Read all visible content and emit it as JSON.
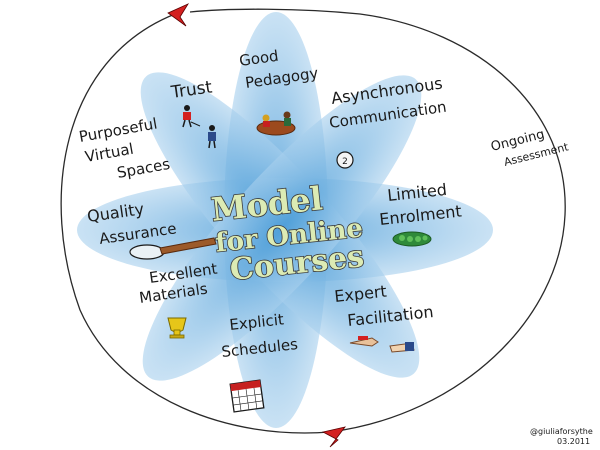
{
  "title": {
    "line1": "Model",
    "line2": "for Online",
    "line3": "Courses"
  },
  "petals": {
    "trust": "Trust",
    "good_pedagogy": [
      "Good",
      "Pedagogy"
    ],
    "asynchronous_communication": [
      "Asynchronous",
      "Communication"
    ],
    "limited_enrolment": [
      "Limited",
      "Enrolment"
    ],
    "expert_facilitation": [
      "Expert",
      "Facilitation"
    ],
    "explicit_schedules": [
      "Explicit",
      "Schedules"
    ],
    "excellent_materials": [
      "Excellent",
      "Materials"
    ],
    "quality_assurance": [
      "Quality",
      "Assurance"
    ]
  },
  "outer_left": [
    "Purposeful",
    "Virtual",
    "Spaces"
  ],
  "outer_right": [
    "Ongoing",
    "Assessment"
  ],
  "signature": [
    "@giuliaforsythe",
    "03.2011"
  ],
  "icons": [
    "people-icon",
    "dinner-table-icon",
    "speech-bubble-icon",
    "peas-pod-icon",
    "pointing-hand-icon",
    "calendar-icon",
    "trophy-icon",
    "magnifying-glass-icon"
  ],
  "colors": {
    "petal_fill": "#7fb8e3",
    "petal_center": "#5fa6dd",
    "title_fill": "#dcebb4",
    "arrow_red": "#d42020"
  }
}
